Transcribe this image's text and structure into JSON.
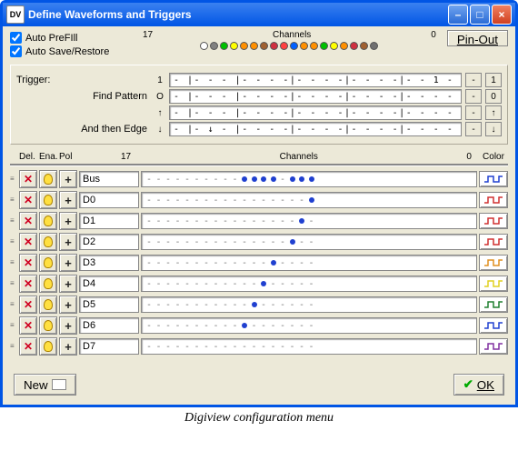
{
  "window": {
    "title": "Define Waveforms and Triggers",
    "icon_text": "DV"
  },
  "toolbar": {
    "auto_prefill": "Auto PreFIll",
    "auto_saverestore": "Auto Save/Restore",
    "channels_label": "Channels",
    "left_num": "17",
    "right_num": "0",
    "pinout": "Pin-Out"
  },
  "channel_colors": [
    "#ffffff",
    "#808080",
    "#00c000",
    "#ffff00",
    "#ff9000",
    "#ff9000",
    "#a06030",
    "#d03040",
    "#ff4040",
    "#0060ff",
    "#ff9000",
    "#ff9000",
    "#00c000",
    "#ffff00",
    "#ff9000",
    "#d03040",
    "#a06030",
    "#707070"
  ],
  "trigger": {
    "label": "Trigger:",
    "find": "Find Pattern",
    "edge": "And then Edge",
    "rows": [
      {
        "num": "1",
        "pat": "- |- - - |- - - -|- - - -|- - - -|- - 1 -",
        "btn": "-",
        "side": "1"
      },
      {
        "num": "O",
        "pat": "- |- - - |- - - -|- - - -|- - - -|- - - -",
        "btn": "-",
        "side": "0"
      },
      {
        "num": "↑",
        "pat": "- |- - - |- - - -|- - - -|- - - -|- - - -",
        "btn": "-",
        "side": "↑"
      },
      {
        "num": "↓",
        "pat": "- |- ↓ - |- - - -|- - - -|- - - -|- - - -",
        "btn": "-",
        "side": "↓"
      }
    ]
  },
  "cols": {
    "del": "Del.",
    "ena": "Ena.",
    "pol": "Pol",
    "left": "17",
    "channels": "Channels",
    "right": "0",
    "color": "Color"
  },
  "rows": [
    {
      "name": "Bus",
      "color": "#2040d0",
      "dots": [
        10,
        11,
        12,
        13,
        15,
        16,
        17
      ]
    },
    {
      "name": "D0",
      "color": "#d03030",
      "dots": [
        17
      ]
    },
    {
      "name": "D1",
      "color": "#d03030",
      "dots": [
        16
      ]
    },
    {
      "name": "D2",
      "color": "#d03030",
      "dots": [
        15
      ]
    },
    {
      "name": "D3",
      "color": "#e09020",
      "dots": [
        13
      ]
    },
    {
      "name": "D4",
      "color": "#e0d020",
      "dots": [
        12
      ]
    },
    {
      "name": "D5",
      "color": "#208030",
      "dots": [
        11
      ]
    },
    {
      "name": "D6",
      "color": "#2040d0",
      "dots": [
        10
      ]
    },
    {
      "name": "D7",
      "color": "#8030a0",
      "dots": []
    }
  ],
  "bottom": {
    "new": "New",
    "ok": "OK"
  },
  "caption": "Digiview configuration menu"
}
